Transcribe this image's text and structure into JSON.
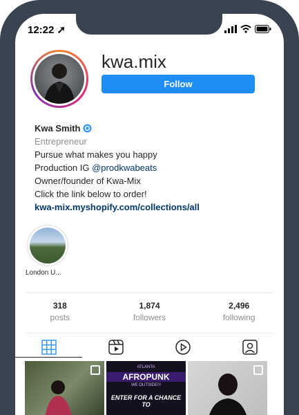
{
  "status": {
    "time": "12:22 ➚"
  },
  "profile": {
    "username": "kwa.mix",
    "follow_label": "Follow",
    "name": "Kwa Smith",
    "category": "Entrepreneur",
    "bio_line1": "Pursue what makes you happy",
    "bio_line2_prefix": "Production IG ",
    "bio_line2_mention": "@prodkwabeats",
    "bio_line3": "Owner/founder of Kwa-Mix",
    "bio_line4": "Click the link below to order!",
    "link": "kwa-mix.myshopify.com/collections/all"
  },
  "highlights": [
    {
      "label": "London U..."
    }
  ],
  "stats": [
    {
      "num": "318",
      "label": "posts"
    },
    {
      "num": "1,874",
      "label": "followers"
    },
    {
      "num": "2,496",
      "label": "following"
    }
  ],
  "tabs": [
    {
      "icon": "grid-icon"
    },
    {
      "icon": "reels-icon"
    },
    {
      "icon": "video-play-icon"
    },
    {
      "icon": "tagged-icon"
    }
  ],
  "posts": [
    {
      "type": "carousel"
    },
    {
      "line1": "ATLANTA",
      "title": "AFROPUNK",
      "line3": "WE OUTSIDE!!!",
      "line4": "ENTER FOR A CHANCE TO"
    },
    {
      "type": "carousel"
    }
  ],
  "colors": {
    "follow_button": "#1e8df5",
    "link": "#00376b",
    "verified": "#3897f0",
    "frame": "#3a4350"
  }
}
